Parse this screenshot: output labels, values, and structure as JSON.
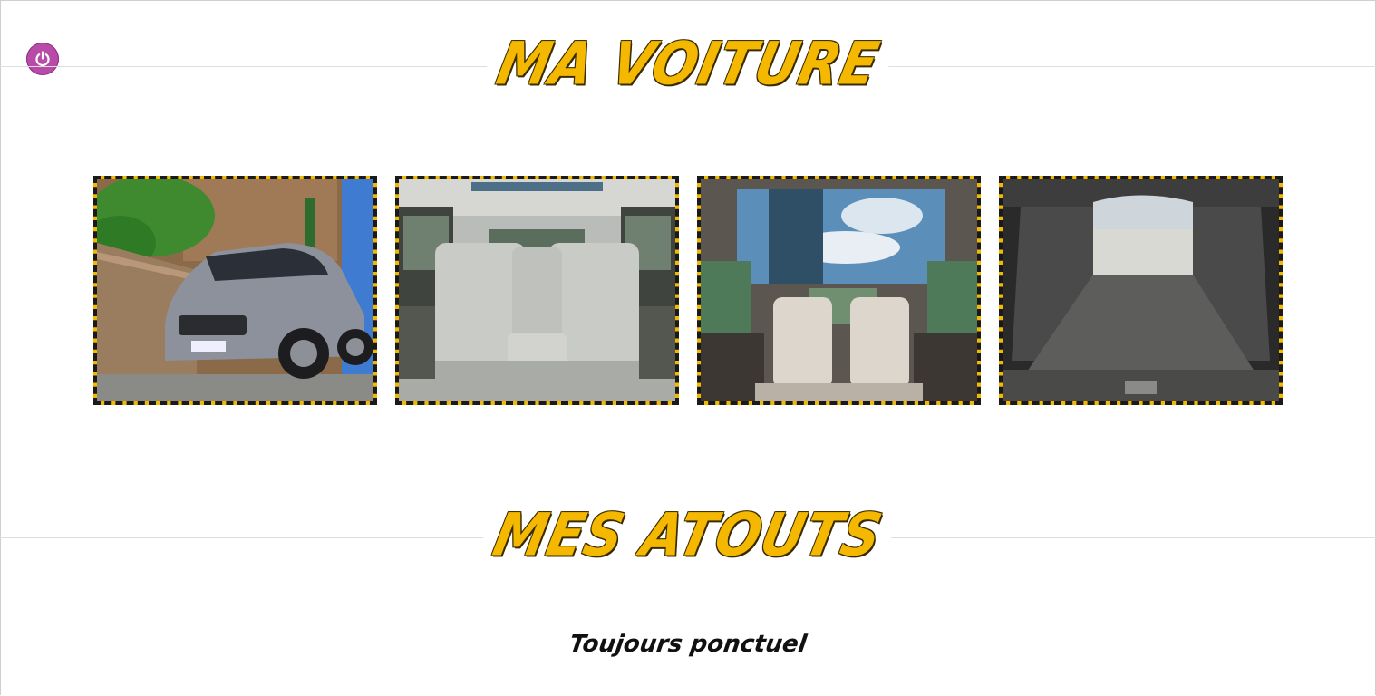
{
  "header": {
    "power_icon": "power-icon"
  },
  "sections": [
    {
      "title": "MA VOITURE"
    },
    {
      "title": "MES ATOUTS"
    }
  ],
  "gallery": {
    "photos": [
      {
        "subject": "car exterior, front three-quarter view"
      },
      {
        "subject": "rear seats interior"
      },
      {
        "subject": "interior view toward panoramic roof"
      },
      {
        "subject": "open trunk with folded seats"
      }
    ]
  },
  "atouts": {
    "items": [
      "Toujours ponctuel"
    ]
  },
  "colors": {
    "accent": "#f5b800",
    "power_button": "#b84aa8",
    "text": "#111111"
  }
}
